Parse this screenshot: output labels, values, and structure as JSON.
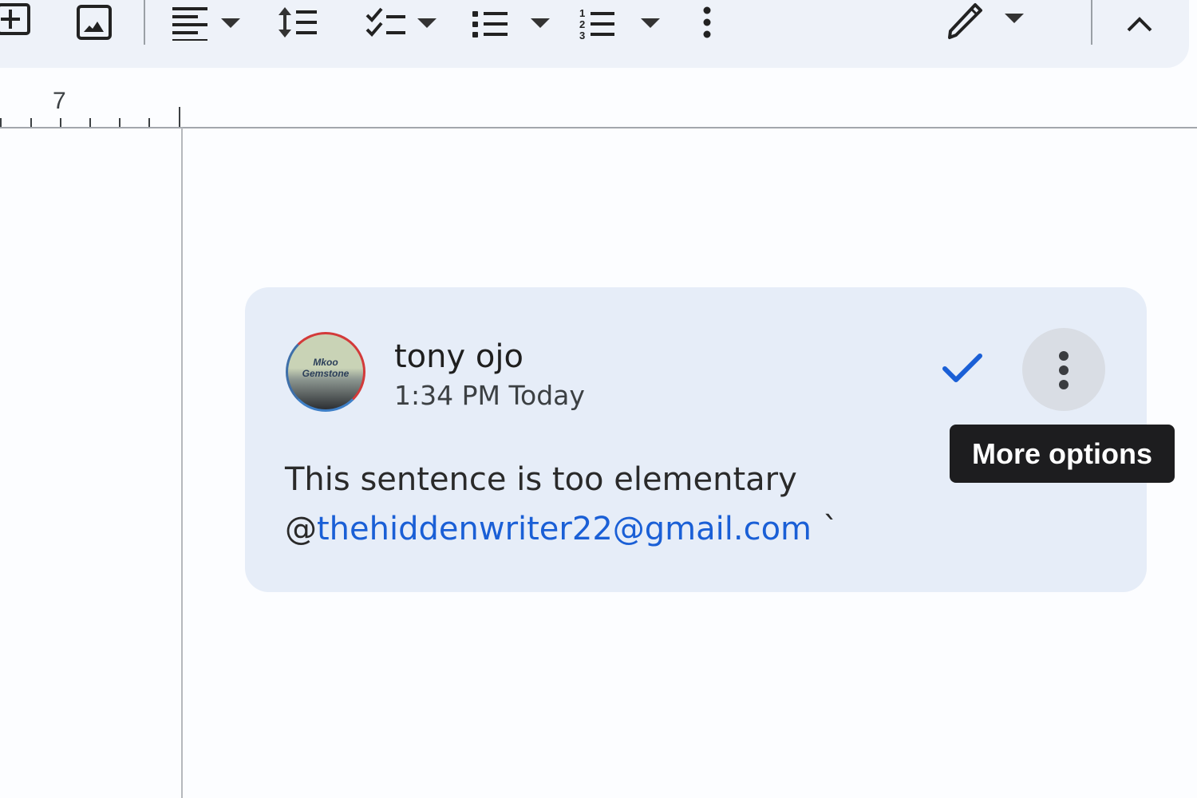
{
  "toolbar": {
    "items": [
      {
        "icon": "insert-plus-icon"
      },
      {
        "icon": "insert-image-icon"
      },
      {
        "icon": "align-left-icon",
        "has_dropdown": true
      },
      {
        "icon": "line-spacing-icon"
      },
      {
        "icon": "checklist-icon",
        "has_dropdown": true
      },
      {
        "icon": "bulleted-list-icon",
        "has_dropdown": true
      },
      {
        "icon": "numbered-list-icon",
        "has_dropdown": true
      },
      {
        "icon": "more-vertical-icon"
      },
      {
        "icon": "editing-mode-pencil-icon",
        "has_dropdown": true
      },
      {
        "icon": "collapse-chevron-up-icon"
      }
    ]
  },
  "ruler": {
    "label": "7"
  },
  "comment": {
    "author": "tony ojo",
    "timestamp": "1:34 PM Today",
    "avatar_text": "Mkoo Gemstone",
    "text": "This sentence is too elementary",
    "mention_prefix": "@",
    "mention": "thehiddenwriter22@gmail.com",
    "trailing": "`",
    "resolve_icon": "checkmark-icon",
    "more_icon": "more-vertical-icon"
  },
  "tooltip": {
    "text": "More options"
  },
  "colors": {
    "accent": "#1a5fd6",
    "card_bg": "#e6edf8",
    "toolbar_bg": "#eef2f9",
    "tooltip_bg": "#1d1d1f"
  }
}
